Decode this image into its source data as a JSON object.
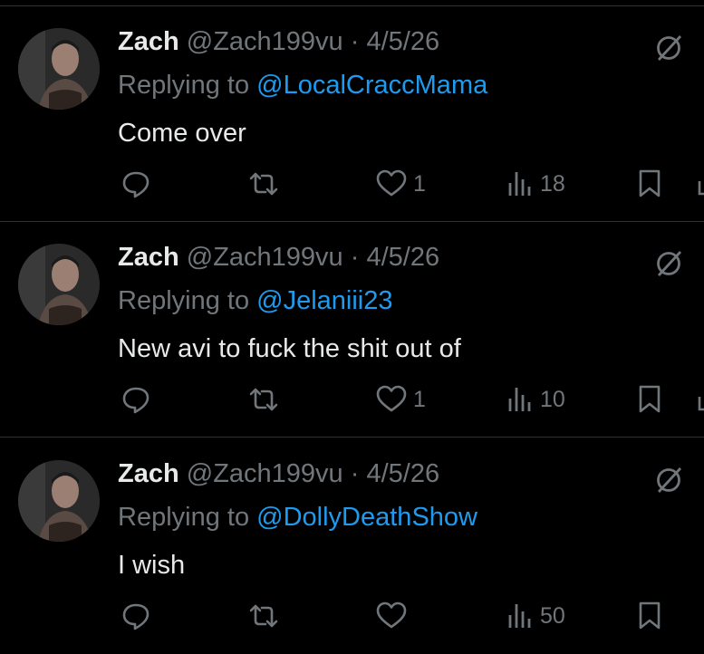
{
  "tweets": [
    {
      "author_name": "Zach",
      "author_handle": "@Zach199vu",
      "separator": "·",
      "date": "4/5/26",
      "replying_prefix": "Replying to",
      "replying_to": "@LocalCraccMama",
      "text": "Come over",
      "likes": "1",
      "views": "18"
    },
    {
      "author_name": "Zach",
      "author_handle": "@Zach199vu",
      "separator": "·",
      "date": "4/5/26",
      "replying_prefix": "Replying to",
      "replying_to": "@Jelaniii23",
      "text": "New avi to fuck the shit out of",
      "likes": "1",
      "views": "10"
    },
    {
      "author_name": "Zach",
      "author_handle": "@Zach199vu",
      "separator": "·",
      "date": "4/5/26",
      "replying_prefix": "Replying to",
      "replying_to": "@DollyDeathShow",
      "text": "I wish",
      "likes": "",
      "views": "50"
    }
  ],
  "colors": {
    "background": "#000000",
    "text": "#e7e9ea",
    "secondary": "#71767b",
    "link": "#1d9bf0",
    "divider": "#2f3336"
  },
  "icons": {
    "reply": "reply-bubble-icon",
    "retweet": "retweet-icon",
    "like": "heart-icon",
    "views": "views-bar-icon",
    "bookmark": "bookmark-icon",
    "more": "block-circle-icon"
  }
}
